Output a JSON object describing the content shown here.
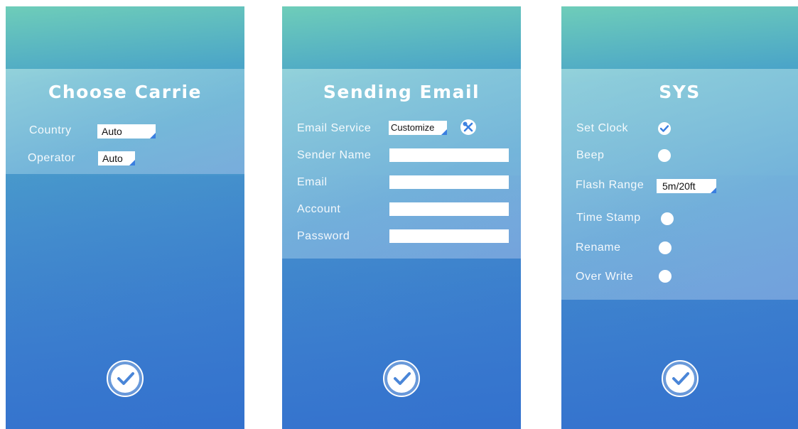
{
  "carrier": {
    "title": "Choose Carrie",
    "country_label": "Country",
    "country_value": "Auto",
    "operator_label": "Operator",
    "operator_value": "Auto"
  },
  "email": {
    "title": "Sending Email",
    "service_label": "Email Service",
    "service_value": "Customize",
    "sender_name_label": "Sender Name",
    "sender_name_value": "",
    "email_label": "Email",
    "email_value": "",
    "account_label": "Account",
    "account_value": "",
    "password_label": "Password",
    "password_value": ""
  },
  "sys": {
    "title": "SYS",
    "set_clock_label": "Set Clock",
    "set_clock_checked": true,
    "beep_label": "Beep",
    "beep_checked": false,
    "flash_range_label": "Flash Range",
    "flash_range_value": "5m/20ft",
    "time_stamp_label": "Time Stamp",
    "time_stamp_checked": false,
    "rename_label": "Rename",
    "rename_checked": false,
    "over_write_label": "Over Write",
    "over_write_checked": false
  },
  "colors": {
    "accent": "#3a7fe0",
    "panel_text": "#ffffff"
  },
  "icons": {
    "confirm": "check-circle-icon",
    "tools": "tools-icon",
    "dropdown": "corner-triangle-icon"
  }
}
